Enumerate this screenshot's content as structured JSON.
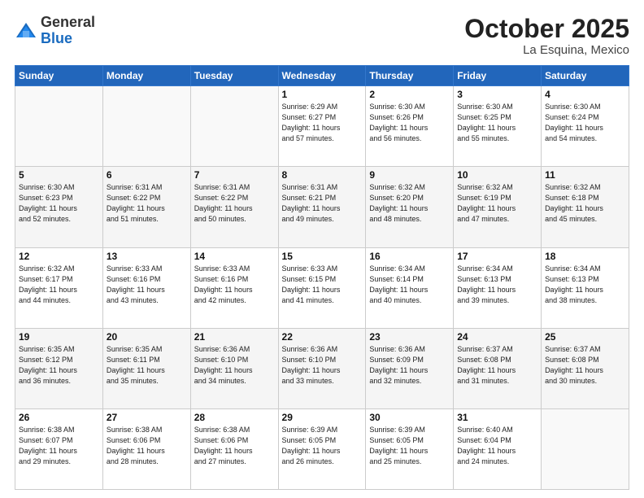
{
  "header": {
    "logo_general": "General",
    "logo_blue": "Blue",
    "title": "October 2025",
    "subtitle": "La Esquina, Mexico"
  },
  "days_of_week": [
    "Sunday",
    "Monday",
    "Tuesday",
    "Wednesday",
    "Thursday",
    "Friday",
    "Saturday"
  ],
  "weeks": [
    [
      {
        "day": "",
        "info": ""
      },
      {
        "day": "",
        "info": ""
      },
      {
        "day": "",
        "info": ""
      },
      {
        "day": "1",
        "info": "Sunrise: 6:29 AM\nSunset: 6:27 PM\nDaylight: 11 hours\nand 57 minutes."
      },
      {
        "day": "2",
        "info": "Sunrise: 6:30 AM\nSunset: 6:26 PM\nDaylight: 11 hours\nand 56 minutes."
      },
      {
        "day": "3",
        "info": "Sunrise: 6:30 AM\nSunset: 6:25 PM\nDaylight: 11 hours\nand 55 minutes."
      },
      {
        "day": "4",
        "info": "Sunrise: 6:30 AM\nSunset: 6:24 PM\nDaylight: 11 hours\nand 54 minutes."
      }
    ],
    [
      {
        "day": "5",
        "info": "Sunrise: 6:30 AM\nSunset: 6:23 PM\nDaylight: 11 hours\nand 52 minutes."
      },
      {
        "day": "6",
        "info": "Sunrise: 6:31 AM\nSunset: 6:22 PM\nDaylight: 11 hours\nand 51 minutes."
      },
      {
        "day": "7",
        "info": "Sunrise: 6:31 AM\nSunset: 6:22 PM\nDaylight: 11 hours\nand 50 minutes."
      },
      {
        "day": "8",
        "info": "Sunrise: 6:31 AM\nSunset: 6:21 PM\nDaylight: 11 hours\nand 49 minutes."
      },
      {
        "day": "9",
        "info": "Sunrise: 6:32 AM\nSunset: 6:20 PM\nDaylight: 11 hours\nand 48 minutes."
      },
      {
        "day": "10",
        "info": "Sunrise: 6:32 AM\nSunset: 6:19 PM\nDaylight: 11 hours\nand 47 minutes."
      },
      {
        "day": "11",
        "info": "Sunrise: 6:32 AM\nSunset: 6:18 PM\nDaylight: 11 hours\nand 45 minutes."
      }
    ],
    [
      {
        "day": "12",
        "info": "Sunrise: 6:32 AM\nSunset: 6:17 PM\nDaylight: 11 hours\nand 44 minutes."
      },
      {
        "day": "13",
        "info": "Sunrise: 6:33 AM\nSunset: 6:16 PM\nDaylight: 11 hours\nand 43 minutes."
      },
      {
        "day": "14",
        "info": "Sunrise: 6:33 AM\nSunset: 6:16 PM\nDaylight: 11 hours\nand 42 minutes."
      },
      {
        "day": "15",
        "info": "Sunrise: 6:33 AM\nSunset: 6:15 PM\nDaylight: 11 hours\nand 41 minutes."
      },
      {
        "day": "16",
        "info": "Sunrise: 6:34 AM\nSunset: 6:14 PM\nDaylight: 11 hours\nand 40 minutes."
      },
      {
        "day": "17",
        "info": "Sunrise: 6:34 AM\nSunset: 6:13 PM\nDaylight: 11 hours\nand 39 minutes."
      },
      {
        "day": "18",
        "info": "Sunrise: 6:34 AM\nSunset: 6:13 PM\nDaylight: 11 hours\nand 38 minutes."
      }
    ],
    [
      {
        "day": "19",
        "info": "Sunrise: 6:35 AM\nSunset: 6:12 PM\nDaylight: 11 hours\nand 36 minutes."
      },
      {
        "day": "20",
        "info": "Sunrise: 6:35 AM\nSunset: 6:11 PM\nDaylight: 11 hours\nand 35 minutes."
      },
      {
        "day": "21",
        "info": "Sunrise: 6:36 AM\nSunset: 6:10 PM\nDaylight: 11 hours\nand 34 minutes."
      },
      {
        "day": "22",
        "info": "Sunrise: 6:36 AM\nSunset: 6:10 PM\nDaylight: 11 hours\nand 33 minutes."
      },
      {
        "day": "23",
        "info": "Sunrise: 6:36 AM\nSunset: 6:09 PM\nDaylight: 11 hours\nand 32 minutes."
      },
      {
        "day": "24",
        "info": "Sunrise: 6:37 AM\nSunset: 6:08 PM\nDaylight: 11 hours\nand 31 minutes."
      },
      {
        "day": "25",
        "info": "Sunrise: 6:37 AM\nSunset: 6:08 PM\nDaylight: 11 hours\nand 30 minutes."
      }
    ],
    [
      {
        "day": "26",
        "info": "Sunrise: 6:38 AM\nSunset: 6:07 PM\nDaylight: 11 hours\nand 29 minutes."
      },
      {
        "day": "27",
        "info": "Sunrise: 6:38 AM\nSunset: 6:06 PM\nDaylight: 11 hours\nand 28 minutes."
      },
      {
        "day": "28",
        "info": "Sunrise: 6:38 AM\nSunset: 6:06 PM\nDaylight: 11 hours\nand 27 minutes."
      },
      {
        "day": "29",
        "info": "Sunrise: 6:39 AM\nSunset: 6:05 PM\nDaylight: 11 hours\nand 26 minutes."
      },
      {
        "day": "30",
        "info": "Sunrise: 6:39 AM\nSunset: 6:05 PM\nDaylight: 11 hours\nand 25 minutes."
      },
      {
        "day": "31",
        "info": "Sunrise: 6:40 AM\nSunset: 6:04 PM\nDaylight: 11 hours\nand 24 minutes."
      },
      {
        "day": "",
        "info": ""
      }
    ]
  ]
}
